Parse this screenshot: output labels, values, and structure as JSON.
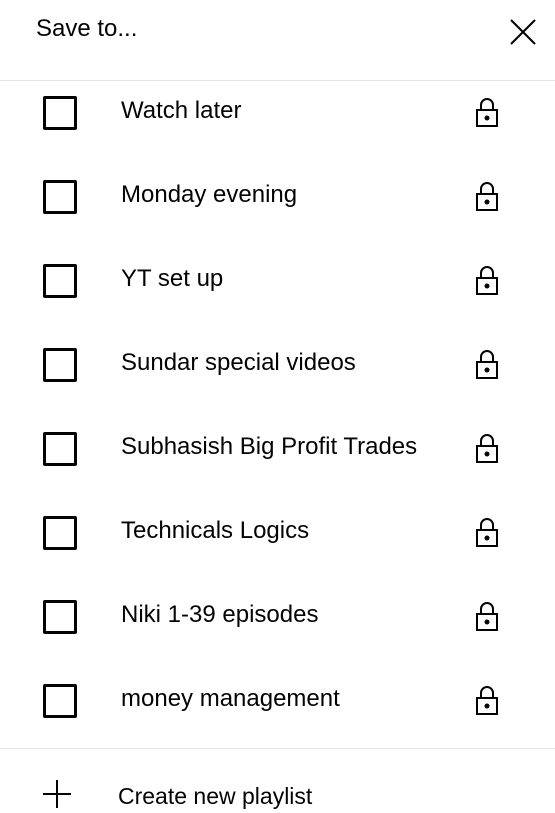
{
  "dialog": {
    "title": "Save to...",
    "close_icon": "close-icon"
  },
  "playlists": [
    {
      "label": "Watch later",
      "checked": false,
      "privacy_icon": "lock-icon"
    },
    {
      "label": "Monday evening",
      "checked": false,
      "privacy_icon": "lock-icon"
    },
    {
      "label": "YT set up",
      "checked": false,
      "privacy_icon": "lock-icon"
    },
    {
      "label": "Sundar special videos",
      "checked": false,
      "privacy_icon": "lock-icon"
    },
    {
      "label": "Subhasish Big Profit Trades",
      "checked": false,
      "privacy_icon": "lock-icon"
    },
    {
      "label": "Technicals Logics",
      "checked": false,
      "privacy_icon": "lock-icon"
    },
    {
      "label": "Niki 1-39 episodes",
      "checked": false,
      "privacy_icon": "lock-icon"
    },
    {
      "label": "money management",
      "checked": false,
      "privacy_icon": "lock-icon"
    }
  ],
  "create": {
    "label": "Create new playlist",
    "icon": "plus-icon"
  },
  "colors": {
    "text": "#030303",
    "divider": "#e5e5e5",
    "background": "#ffffff"
  }
}
